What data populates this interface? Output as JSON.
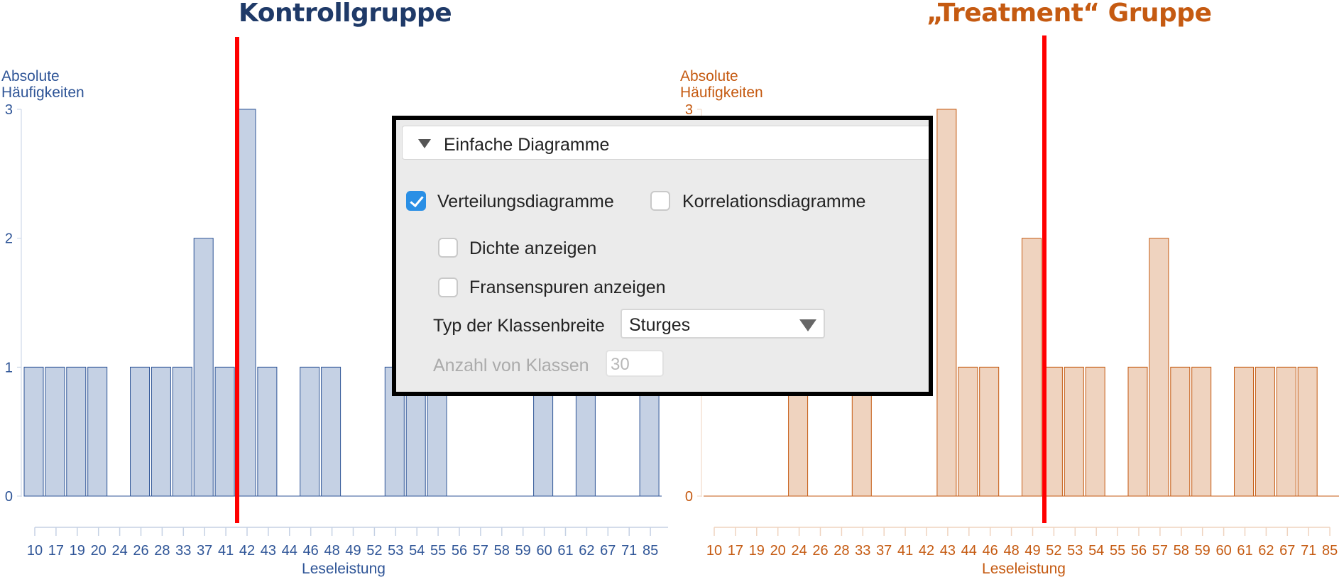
{
  "titles": {
    "left": "Kontrollgruppe",
    "right": "„Treatment“ Gruppe"
  },
  "chart_data": [
    {
      "type": "bar",
      "title": "Kontrollgruppe",
      "ylabel": "Absolute Häufigkeiten",
      "xlabel": "Leseleistung",
      "color": "#2f5597",
      "fill": "#c5d1e4",
      "ylim": [
        0,
        3
      ],
      "yticks": [
        0,
        1,
        2,
        3
      ],
      "categories": [
        "10",
        "17",
        "19",
        "20",
        "24",
        "26",
        "28",
        "33",
        "37",
        "41",
        "42",
        "43",
        "44",
        "46",
        "48",
        "49",
        "52",
        "53",
        "54",
        "55",
        "56",
        "57",
        "58",
        "59",
        "60",
        "61",
        "62",
        "67",
        "71",
        "85"
      ],
      "values": [
        1,
        1,
        1,
        1,
        0,
        1,
        1,
        1,
        2,
        1,
        3,
        1,
        0,
        1,
        1,
        0,
        0,
        1,
        1,
        1,
        0,
        0,
        0,
        0,
        1,
        0,
        1,
        0,
        0,
        1
      ],
      "mean_line": {
        "value": 41.6,
        "color": "#ff0000"
      }
    },
    {
      "type": "bar",
      "title": "„Treatment“ Gruppe",
      "ylabel": "Absolute Häufigkeiten",
      "xlabel": "Leseleistung",
      "color": "#c55a11",
      "fill": "#efd3bf",
      "ylim": [
        0,
        3
      ],
      "yticks": [
        0,
        3
      ],
      "categories": [
        "10",
        "17",
        "19",
        "20",
        "24",
        "26",
        "28",
        "33",
        "37",
        "41",
        "42",
        "43",
        "44",
        "46",
        "48",
        "49",
        "52",
        "53",
        "54",
        "55",
        "56",
        "57",
        "58",
        "59",
        "60",
        "61",
        "62",
        "67",
        "71",
        "85"
      ],
      "values": [
        0,
        0,
        0,
        0,
        1,
        0,
        0,
        1,
        0,
        0,
        0,
        3,
        1,
        1,
        0,
        2,
        1,
        1,
        1,
        0,
        1,
        2,
        1,
        1,
        0,
        1,
        1,
        1,
        1,
        0
      ],
      "mean_line": {
        "value": 49.6,
        "color": "#ff0000"
      }
    }
  ],
  "panel": {
    "header": "Einfache Diagramme",
    "header_icon": "triangle-down-icon",
    "distribution": {
      "label": "Verteilungsdiagramme",
      "checked": true
    },
    "correlation": {
      "label": "Korrelationsdiagramme",
      "checked": false
    },
    "density": {
      "label": "Dichte anzeigen",
      "checked": false
    },
    "rug": {
      "label": "Fransenspuren anzeigen",
      "checked": false
    },
    "bin_type_label": "Typ der Klassenbreite",
    "bin_type_value": "Sturges",
    "bin_count_label": "Anzahl von Klassen",
    "bin_count_value": "30",
    "accent": "#2a8fe5"
  }
}
